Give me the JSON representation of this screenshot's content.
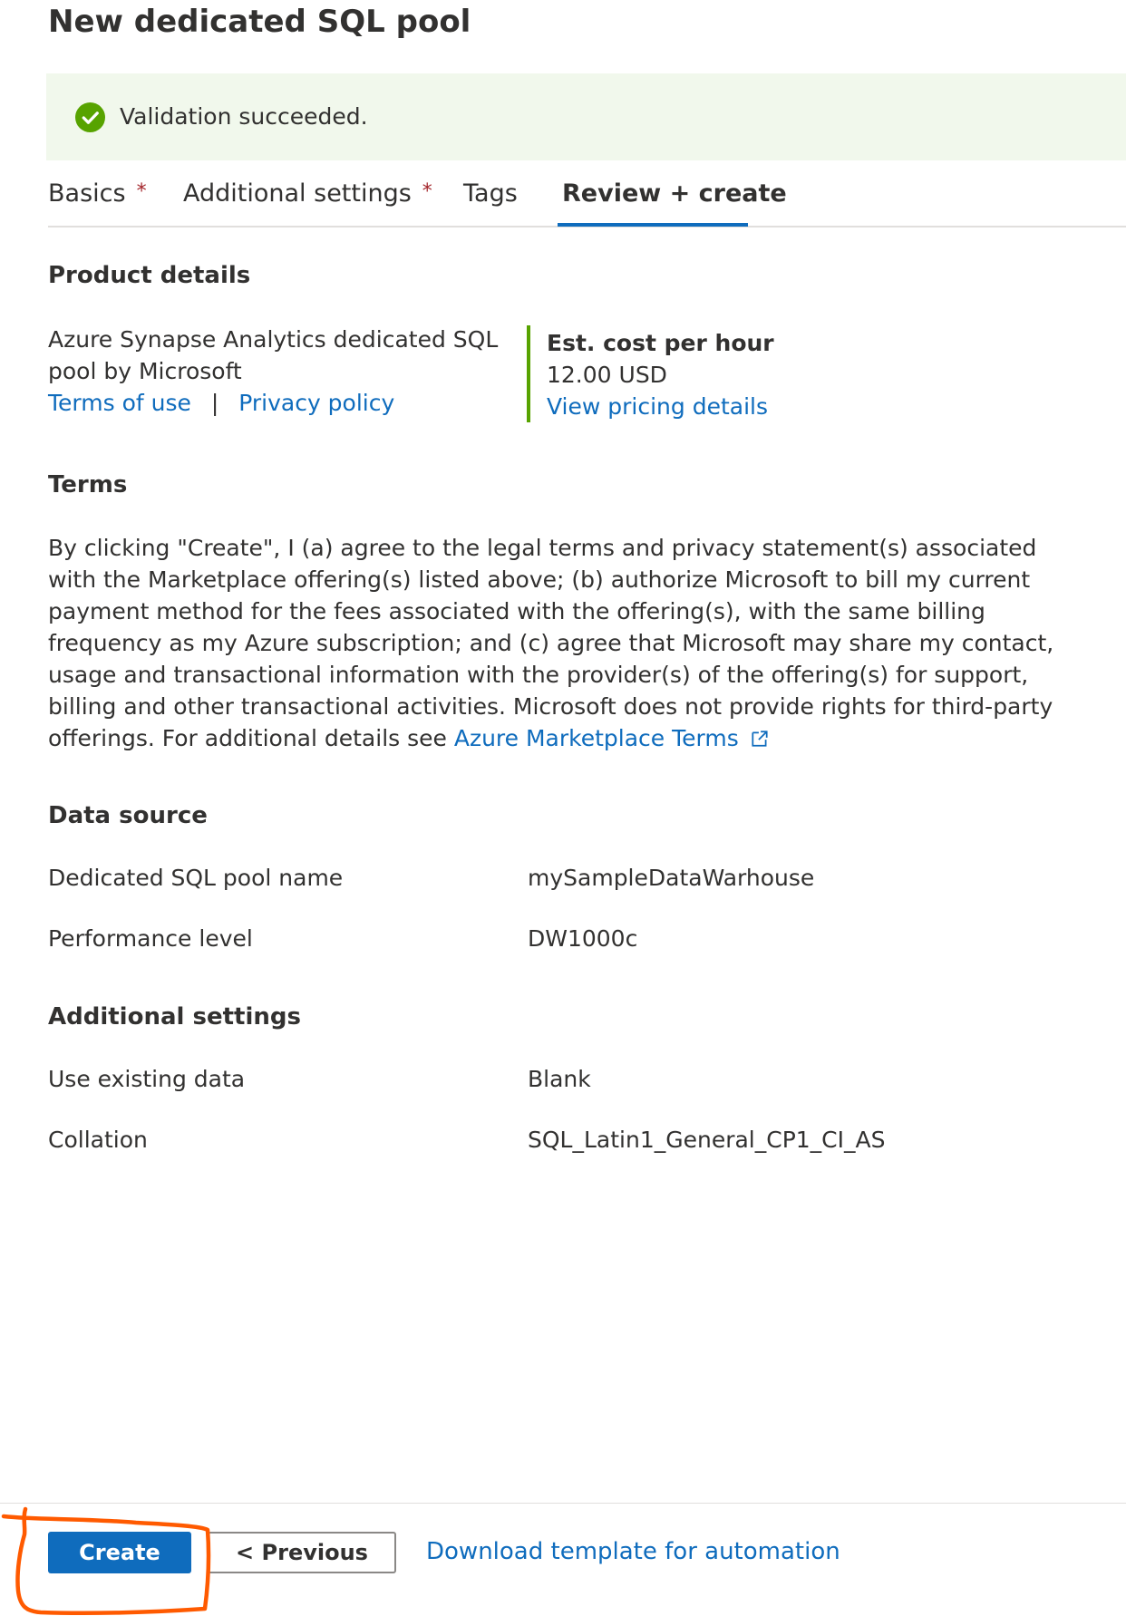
{
  "page": {
    "title": "New dedicated SQL pool"
  },
  "validation": {
    "message": "Validation succeeded.",
    "status_color": "#57a300"
  },
  "tabs": [
    {
      "label": "Basics",
      "required_marker": "*",
      "active": false
    },
    {
      "label": "Additional settings",
      "required_marker": "*",
      "active": false
    },
    {
      "label": "Tags",
      "required_marker": "",
      "active": false
    },
    {
      "label": "Review + create",
      "required_marker": "",
      "active": true
    }
  ],
  "product_details": {
    "heading": "Product details",
    "product_line1": "Azure Synapse Analytics dedicated SQL",
    "product_line2": "pool by Microsoft",
    "terms_link": "Terms of use",
    "separator": "|",
    "privacy_link": "Privacy policy",
    "cost_label": "Est. cost per hour",
    "cost_value": "12.00 USD",
    "pricing_link": "View pricing details"
  },
  "terms": {
    "heading": "Terms",
    "lines": [
      "By clicking \"Create\", I (a) agree to the legal terms and privacy statement(s) associated",
      "with the Marketplace offering(s) listed above; (b) authorize Microsoft to bill my current",
      "payment method for the fees associated with the offering(s), with the same billing",
      "frequency as my Azure subscription; and (c) agree that Microsoft may share my contact,",
      "usage and transactional information with the provider(s) of the offering(s) for support,",
      "billing and other transactional activities. Microsoft does not provide rights for third-party"
    ],
    "last_line_prefix": "offerings. For additional details see ",
    "marketplace_link": "Azure Marketplace Terms"
  },
  "data_source": {
    "heading": "Data source",
    "rows": [
      {
        "label": "Dedicated SQL pool name",
        "value": "mySampleDataWarhouse"
      },
      {
        "label": "Performance level",
        "value": "DW1000c"
      }
    ]
  },
  "additional_settings": {
    "heading": "Additional settings",
    "rows": [
      {
        "label": "Use existing data",
        "value": "Blank"
      },
      {
        "label": "Collation",
        "value": "SQL_Latin1_General_CP1_CI_AS"
      }
    ]
  },
  "footer": {
    "create_label": "Create",
    "previous_label": "< Previous",
    "download_link": "Download template for automation"
  },
  "colors": {
    "accent": "#0f6cbd",
    "success_bg": "#f1f8ec",
    "annotation": "#ff5a00"
  },
  "icons": {
    "validation": "checkmark-circle-icon",
    "external_link": "open-in-new-window-icon"
  }
}
